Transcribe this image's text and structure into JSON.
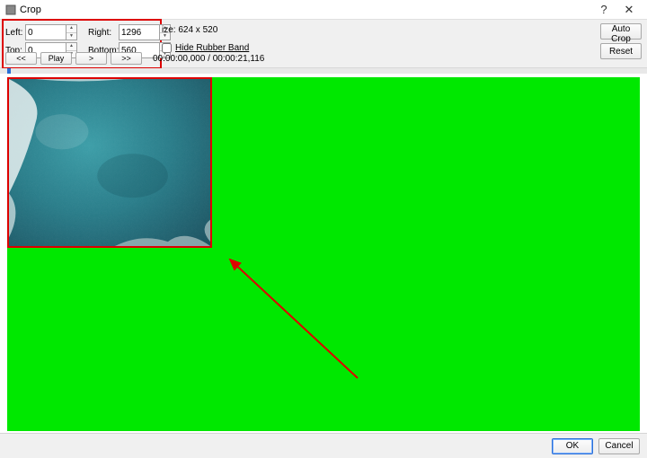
{
  "window": {
    "title": "Crop",
    "help": "?",
    "close": "✕"
  },
  "controls": {
    "left_label": "Left:",
    "left_value": "0",
    "right_label": "Right:",
    "right_value": "1296",
    "top_label": "Top:",
    "top_value": "0",
    "bottom_label": "Bottom:",
    "bottom_value": "560",
    "size_label": "ize:",
    "size_value": "624 x 520",
    "hide_label": "Hide Rubber Band",
    "auto_crop": "Auto Crop",
    "reset": "Reset"
  },
  "playback": {
    "rewind": "<<",
    "play": "Play",
    "step": ">",
    "fwd": ">>",
    "timecode": "00:00:00,000 / 00:00:21,116"
  },
  "footer": {
    "ok": "OK",
    "cancel": "Cancel"
  }
}
